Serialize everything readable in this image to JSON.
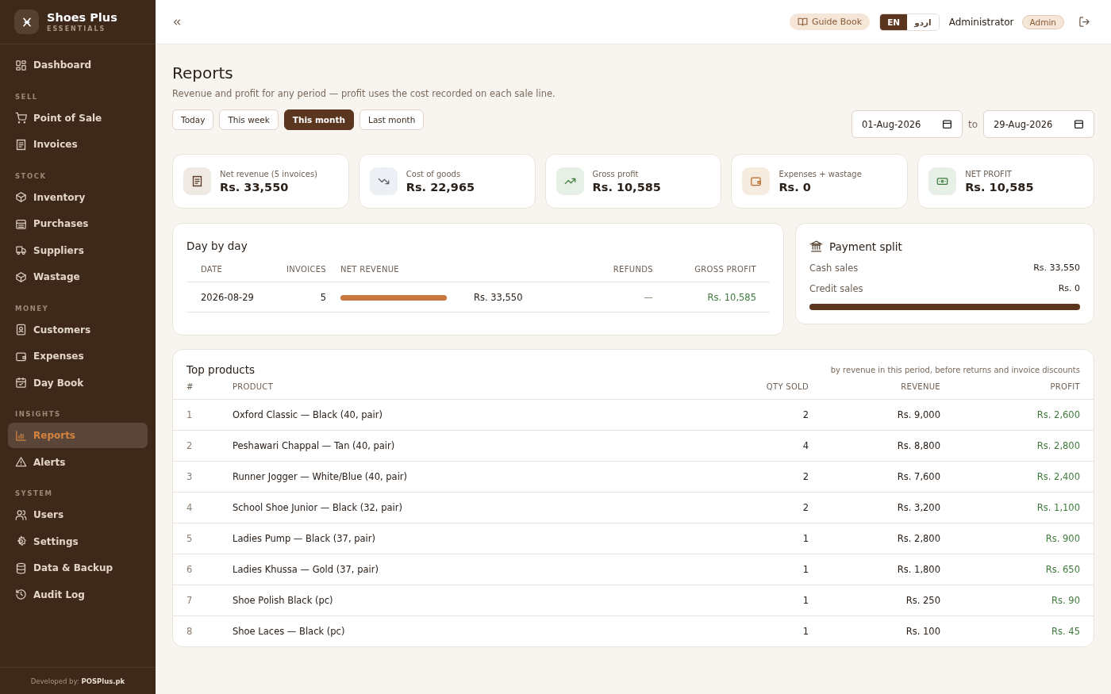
{
  "sidebar": {
    "brand": {
      "name": "Shoes Plus",
      "tagline": "ESSENTIALS"
    },
    "sections": [
      {
        "items": [
          {
            "label": "Dashboard",
            "selected": false
          }
        ]
      },
      {
        "heading": "SELL",
        "items": [
          {
            "label": "Point of Sale",
            "selected": false
          },
          {
            "label": "Invoices",
            "selected": false
          }
        ]
      },
      {
        "heading": "STOCK",
        "items": [
          {
            "label": "Inventory",
            "selected": false
          },
          {
            "label": "Purchases",
            "selected": false
          },
          {
            "label": "Suppliers",
            "selected": false
          },
          {
            "label": "Wastage",
            "selected": false
          }
        ]
      },
      {
        "heading": "MONEY",
        "items": [
          {
            "label": "Customers",
            "selected": false
          },
          {
            "label": "Expenses",
            "selected": false
          },
          {
            "label": "Day Book",
            "selected": false
          }
        ]
      },
      {
        "heading": "INSIGHTS",
        "items": [
          {
            "label": "Reports",
            "selected": true
          },
          {
            "label": "Alerts",
            "selected": false
          }
        ]
      },
      {
        "heading": "SYSTEM",
        "items": [
          {
            "label": "Users",
            "selected": false
          },
          {
            "label": "Settings",
            "selected": false
          },
          {
            "label": "Data & Backup",
            "selected": false
          },
          {
            "label": "Audit Log",
            "selected": false
          }
        ]
      }
    ],
    "footer": "Developed by: **POSPlus.pk**"
  },
  "topbar": {
    "guide_book": "Guide Book",
    "languages": [
      {
        "label": "EN",
        "selected": true
      },
      {
        "label": "اردو",
        "selected": false
      }
    ],
    "user": "Administrator",
    "role": "Admin"
  },
  "page": {
    "title": "Reports",
    "subtitle": "Revenue and profit for any period — profit uses the cost recorded on each sale line.",
    "periods": [
      {
        "label": "Today",
        "selected": false
      },
      {
        "label": "This week",
        "selected": false
      },
      {
        "label": "This month",
        "selected": true
      },
      {
        "label": "Last month",
        "selected": false
      }
    ],
    "date_from": "01-Aug-2026",
    "date_separator": "to",
    "date_to": "29-Aug-2026"
  },
  "stats": [
    {
      "label": "Net revenue (5 invoices)",
      "value": "Rs. 33,550"
    },
    {
      "label": "Cost of goods",
      "value": "Rs. 22,965"
    },
    {
      "label": "Gross profit",
      "value": "Rs. 10,585"
    },
    {
      "label": "Expenses + wastage",
      "value": "Rs. 0"
    },
    {
      "label": "NET PROFIT",
      "value": "Rs. 10,585"
    }
  ],
  "day_by_day": {
    "title": "Day by day",
    "columns": [
      "DATE",
      "INVOICES",
      "NET REVENUE",
      "REFUNDS",
      "GROSS PROFIT"
    ],
    "rows": [
      {
        "date": "2026-08-29",
        "invoices": "5",
        "level": 1,
        "net_revenue": "Rs. 33,550",
        "refunds": "—",
        "gross_profit": "Rs. 10,585"
      }
    ]
  },
  "payment_split": {
    "title": "Payment split",
    "rows": [
      {
        "label": "Cash sales",
        "value": "Rs. 33,550"
      },
      {
        "label": "Credit sales",
        "value": "Rs. 0"
      }
    ],
    "level": 1
  },
  "top_products": {
    "title": "Top products",
    "note": "by revenue in this period, before returns and invoice discounts",
    "columns": [
      "#",
      "PRODUCT",
      "QTY SOLD",
      "REVENUE",
      "PROFIT"
    ],
    "rows": [
      {
        "rank": "1",
        "product": "Oxford Classic — Black (40, pair)",
        "qty": "2",
        "revenue": "Rs. 9,000",
        "profit": "Rs. 2,600"
      },
      {
        "rank": "2",
        "product": "Peshawari Chappal — Tan (40, pair)",
        "qty": "4",
        "revenue": "Rs. 8,800",
        "profit": "Rs. 2,800"
      },
      {
        "rank": "3",
        "product": "Runner Jogger — White/Blue (40, pair)",
        "qty": "2",
        "revenue": "Rs. 7,600",
        "profit": "Rs. 2,400"
      },
      {
        "rank": "4",
        "product": "School Shoe Junior — Black (32, pair)",
        "qty": "2",
        "revenue": "Rs. 3,200",
        "profit": "Rs. 1,100"
      },
      {
        "rank": "5",
        "product": "Ladies Pump — Black (37, pair)",
        "qty": "1",
        "revenue": "Rs. 2,800",
        "profit": "Rs. 900"
      },
      {
        "rank": "6",
        "product": "Ladies Khussa — Gold (37, pair)",
        "qty": "1",
        "revenue": "Rs. 1,800",
        "profit": "Rs. 650"
      },
      {
        "rank": "7",
        "product": "Shoe Polish Black (pc)",
        "qty": "1",
        "revenue": "Rs. 250",
        "profit": "Rs. 90"
      },
      {
        "rank": "8",
        "product": "Shoe Laces — Black (pc)",
        "qty": "1",
        "revenue": "Rs. 100",
        "profit": "Rs. 45"
      }
    ]
  }
}
